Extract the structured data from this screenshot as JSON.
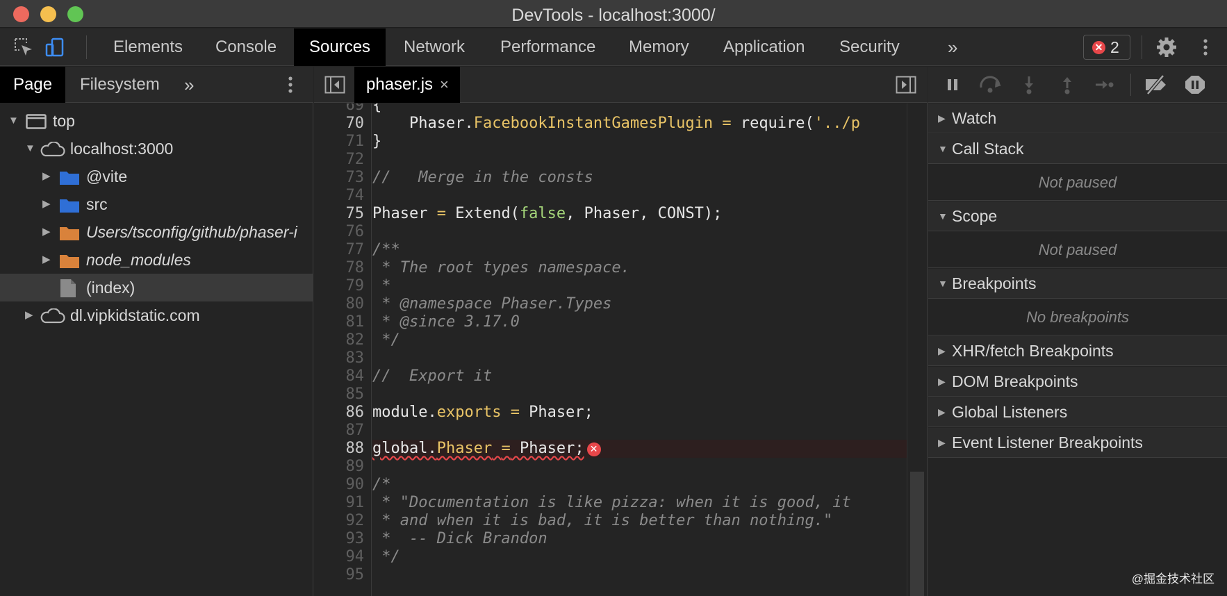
{
  "window": {
    "title": "DevTools - localhost:3000/"
  },
  "tabbar": {
    "tabs": [
      {
        "label": "Elements"
      },
      {
        "label": "Console"
      },
      {
        "label": "Sources"
      },
      {
        "label": "Network"
      },
      {
        "label": "Performance"
      },
      {
        "label": "Memory"
      },
      {
        "label": "Application"
      },
      {
        "label": "Security"
      }
    ],
    "active_tab": "Sources",
    "more_label": "»",
    "error_count": "2"
  },
  "navigator": {
    "tabs": [
      {
        "label": "Page"
      },
      {
        "label": "Filesystem"
      }
    ],
    "more_label": "»",
    "tree": [
      {
        "label": "top"
      },
      {
        "label": "localhost:3000"
      },
      {
        "label": "@vite"
      },
      {
        "label": "src"
      },
      {
        "label": "Users/tsconfig/github/phaser-i"
      },
      {
        "label": "node_modules"
      },
      {
        "label": "(index)"
      },
      {
        "label": "dl.vipkidstatic.com"
      }
    ]
  },
  "editor": {
    "file_tab": "phaser.js",
    "close_label": "×",
    "lines": [
      {
        "num": "69",
        "text": "{"
      },
      {
        "num": "70",
        "text": "    Phaser.FacebookInstantGamesPlugin = require('../p"
      },
      {
        "num": "71",
        "text": "}"
      },
      {
        "num": "72",
        "text": ""
      },
      {
        "num": "73",
        "text": "//   Merge in the consts"
      },
      {
        "num": "74",
        "text": ""
      },
      {
        "num": "75",
        "text": "Phaser = Extend(false, Phaser, CONST);"
      },
      {
        "num": "76",
        "text": ""
      },
      {
        "num": "77",
        "text": "/**"
      },
      {
        "num": "78",
        "text": " * The root types namespace."
      },
      {
        "num": "79",
        "text": " *"
      },
      {
        "num": "80",
        "text": " * @namespace Phaser.Types"
      },
      {
        "num": "81",
        "text": " * @since 3.17.0"
      },
      {
        "num": "82",
        "text": " */"
      },
      {
        "num": "83",
        "text": ""
      },
      {
        "num": "84",
        "text": "//  Export it"
      },
      {
        "num": "85",
        "text": ""
      },
      {
        "num": "86",
        "text": "module.exports = Phaser;"
      },
      {
        "num": "87",
        "text": ""
      },
      {
        "num": "88",
        "text": "global.Phaser = Phaser;"
      },
      {
        "num": "89",
        "text": ""
      },
      {
        "num": "90",
        "text": "/*"
      },
      {
        "num": "91",
        "text": " * \"Documentation is like pizza: when it is good, it"
      },
      {
        "num": "92",
        "text": " * and when it is bad, it is better than nothing.\""
      },
      {
        "num": "93",
        "text": " *  -- Dick Brandon"
      },
      {
        "num": "94",
        "text": " */"
      },
      {
        "num": "95",
        "text": ""
      }
    ]
  },
  "debugger": {
    "sections": {
      "watch": "Watch",
      "call_stack": "Call Stack",
      "call_stack_msg": "Not paused",
      "scope": "Scope",
      "scope_msg": "Not paused",
      "breakpoints": "Breakpoints",
      "breakpoints_msg": "No breakpoints",
      "xhr": "XHR/fetch Breakpoints",
      "dom": "DOM Breakpoints",
      "global": "Global Listeners",
      "event": "Event Listener Breakpoints"
    }
  },
  "watermark": "@掘金技术社区",
  "colors": {
    "error": "#e8474a",
    "keyword": "#a5d67a",
    "property": "#e8c366",
    "comment": "#8a8a8a",
    "folder_blue": "#2f6fd6",
    "folder_orange": "#d9823b"
  }
}
